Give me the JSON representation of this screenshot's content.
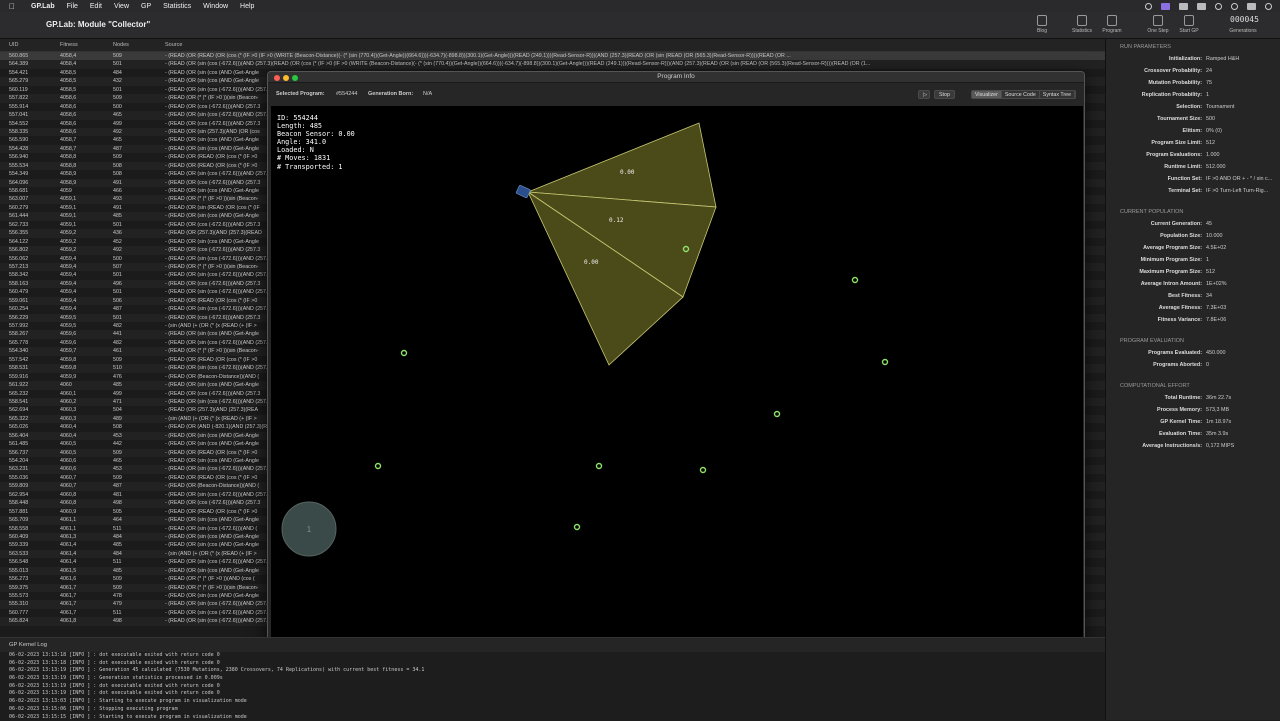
{
  "menubar": {
    "app_name": "GP.Lab",
    "items": [
      "File",
      "Edit",
      "View",
      "GP",
      "Statistics",
      "Window",
      "Help"
    ]
  },
  "window": {
    "title": "GP.Lab: Module \"Collector\""
  },
  "toolbar": {
    "blog": "Blog",
    "statistics": "Statistics",
    "program": "Program",
    "one_step": "One Step",
    "start_gp": "Start GP",
    "generations_value": "000045",
    "generations_label": "Generations"
  },
  "table": {
    "headers": {
      "uid": "UID",
      "fitness": "Fitness",
      "nodes": "Nodes",
      "source": "Source"
    },
    "selected_full_source": "- (READ (OR (READ (OR (cos (* (IF >0 (IF >0 (WRITE (Beacon-Distance)(- (* (sin (770.4))(Get-Angle))(664.6)))(-634.7)(-898.8))(300.1)(Get-Angle)))(READ (249.1)))(Read-Sensor-R)))(AND (257.3)(READ (OR (sin (READ (OR (565.3)(Read-Sensor-R))))(READ (OR ...",
    "second_full_source": "- (READ (OR (sin (cos (-672.6)))(AND (257.3)(READ (OR (cos (* (IF >0 (IF >0 (WRITE (Beacon-Distance)(- (* (sin (770.4))(Get-Angle))(664.6)))(-634.7)(-898.8))(300.1)(Get-Angle)))(READ (249.1)))(Read-Sensor-R)))(AND (257.3)(READ (OR (sin (READ (OR (565.3)(Read-Sensor-R))))(READ (OR (1...",
    "rows": [
      [
        "560.865",
        "4058,4",
        "509",
        "- (READ (OR (READ (OR (cos (* (IF >0 (IF >0 (WRITE (Beacon-Distance"
      ],
      [
        "564.389",
        "4058,4",
        "501",
        "- (READ (OR (sin (cos (-672.6)))(AND (257.3)(READ (OR (cos (* (IF >0"
      ],
      [
        "554.421",
        "4058,5",
        "484",
        "- (READ (OR (sin (cos (AND (Get-Angle"
      ],
      [
        "565.279",
        "4058,5",
        "432",
        "- (READ (OR (sin (cos (AND (Get-Angle"
      ],
      [
        "560.119",
        "4058,5",
        "501",
        "- (READ (OR (sin (cos (-672.6)))(AND (257."
      ],
      [
        "557.822",
        "4058,6",
        "509",
        "- (READ (OR (* (* (IF >0 ))(sin (Beacon-"
      ],
      [
        "555.914",
        "4058,6",
        "500",
        "- (READ (OR (cos (-672.6)))(AND (257.3"
      ],
      [
        "557.041",
        "4058,6",
        "465",
        "- (READ (OR (sin (cos (-672.6)))(AND (257."
      ],
      [
        "554.552",
        "4058,6",
        "499",
        "- (READ (OR (cos (-672.6)))(AND (257.3"
      ],
      [
        "558.335",
        "4058,6",
        "492",
        "- (READ (OR (sin (257.3)(AND (OR (cos"
      ],
      [
        "565.590",
        "4058,7",
        "465",
        "- (READ (OR (sin (cos (AND (Get-Angle"
      ],
      [
        "554.428",
        "4058,7",
        "487",
        "- (READ (OR (sin (cos (AND (Get-Angle"
      ],
      [
        "556.940",
        "4058,8",
        "509",
        "- (READ (OR (READ (OR (cos (* (IF >0"
      ],
      [
        "555.534",
        "4058,8",
        "508",
        "- (READ (OR (READ (OR (cos (* (IF >0"
      ],
      [
        "554.349",
        "4058,9",
        "508",
        "- (READ (OR (sin (cos (-672.6)))(AND (257."
      ],
      [
        "564.096",
        "4058,9",
        "491",
        "- (READ (OR (cos (-672.6)))(AND (257.3"
      ],
      [
        "558.681",
        "4059",
        "466",
        "- (READ (OR (sin (cos (AND (Get-Angle"
      ],
      [
        "563.007",
        "4059,1",
        "493",
        "- (READ (OR (* (* (IF >0 ))(sin (Beacon-"
      ],
      [
        "560.279",
        "4059,1",
        "491",
        "- (READ (OR (sin (READ (OR (cos (* (IF"
      ],
      [
        "561.444",
        "4059,1",
        "485",
        "- (READ (OR (sin (cos (AND (Get-Angle"
      ],
      [
        "562.733",
        "4059,1",
        "501",
        "- (READ (OR (cos (-672.6)))(AND (257.3"
      ],
      [
        "556.355",
        "4059,2",
        "436",
        "- (READ (OR (257.3)(AND (257.3)(READ"
      ],
      [
        "564.122",
        "4059,2",
        "452",
        "- (READ (OR (sin (cos (AND (Get-Angle"
      ],
      [
        "556.802",
        "4059,2",
        "492",
        "- (READ (OR (cos (-672.6)))(AND (257.3"
      ],
      [
        "556.062",
        "4059,4",
        "500",
        "- (READ (OR (sin (cos (-672.6)))(AND (257."
      ],
      [
        "557.213",
        "4059,4",
        "507",
        "- (READ (OR (* (* (IF >0 ))(sin (Beacon-"
      ],
      [
        "558.342",
        "4059,4",
        "501",
        "- (READ (OR (sin (cos (-672.6)))(AND (257."
      ],
      [
        "558.163",
        "4059,4",
        "496",
        "- (READ (OR (cos (-672.6)))(AND (257.3"
      ],
      [
        "560.479",
        "4059,4",
        "501",
        "- (READ (OR (sin (cos (-672.6)))(AND (257."
      ],
      [
        "559.061",
        "4059,4",
        "506",
        "- (READ (OR (READ (OR (cos (* (IF >0"
      ],
      [
        "560.254",
        "4059,4",
        "487",
        "- (READ (OR (sin (cos (-672.6)))(AND (257."
      ],
      [
        "556.229",
        "4059,5",
        "501",
        "- (READ (OR (cos (-672.6)))(AND (257.3"
      ],
      [
        "557.992",
        "4059,5",
        "482",
        "- (sin (AND (+ (OR (* (x (READ (+ (IF >"
      ],
      [
        "558.267",
        "4059,6",
        "441",
        "- (READ (OR (sin (cos (AND (Get-Angle"
      ],
      [
        "565.778",
        "4059,6",
        "482",
        "- (READ (OR (sin (cos (-672.6)))(AND (257."
      ],
      [
        "554.340",
        "4059,7",
        "461",
        "- (READ (OR (* (* (IF >0 ))(sin (Beacon-"
      ],
      [
        "557.542",
        "4059,8",
        "509",
        "- (READ (OR (READ (OR (cos (* (IF >0"
      ],
      [
        "558.531",
        "4059,8",
        "510",
        "- (READ (OR (sin (cos (-672.6)))(AND (257."
      ],
      [
        "559.916",
        "4059,9",
        "476",
        "- (READ (OR (Beacon-Distance))(AND ("
      ],
      [
        "561.922",
        "4060",
        "485",
        "- (READ (OR (sin (cos (AND (Get-Angle"
      ],
      [
        "565.232",
        "4060,1",
        "499",
        "- (READ (OR (cos (-672.6)))(AND (257.3"
      ],
      [
        "558.541",
        "4060,2",
        "471",
        "- (READ (OR (sin (cos (-672.6)))(AND (257."
      ],
      [
        "562.694",
        "4060,3",
        "504",
        "- (READ (OR (257.3)(AND (257.3)(REA"
      ],
      [
        "565.322",
        "4060,3",
        "489",
        "- (sin (AND (+ (OR (* (x (READ (+ (IF >"
      ],
      [
        "565.026",
        "4060,4",
        "508",
        "- (READ (OR (AND (-820.1)(AND (257.3)(REA"
      ],
      [
        "556.404",
        "4060,4",
        "453",
        "- (READ (OR (sin (cos (AND (Get-Angle"
      ],
      [
        "561.485",
        "4060,5",
        "442",
        "- (READ (OR (sin (cos (AND (Get-Angle"
      ],
      [
        "556.737",
        "4060,5",
        "509",
        "- (READ (OR (READ (OR (cos (* (IF >0"
      ],
      [
        "554.204",
        "4060,6",
        "465",
        "- (READ (OR (sin (cos (AND (Get-Angle"
      ],
      [
        "563.231",
        "4060,6",
        "453",
        "- (READ (OR (sin (cos (-672.6)))(AND (257."
      ],
      [
        "555.036",
        "4060,7",
        "509",
        "- (READ (OR (READ (OR (cos (* (IF >0"
      ],
      [
        "559.809",
        "4060,7",
        "487",
        "- (READ (OR (Beacon-Distance))(AND ("
      ],
      [
        "562.954",
        "4060,8",
        "481",
        "- (READ (OR (sin (cos (-672.6)))(AND (257."
      ],
      [
        "558.448",
        "4060,8",
        "498",
        "- (READ (OR (cos (-672.6)))(AND (257.3"
      ],
      [
        "557.881",
        "4060,9",
        "505",
        "- (READ (OR (READ (OR (cos (* (IF >0"
      ],
      [
        "565.709",
        "4061,1",
        "464",
        "- (READ (OR (sin (cos (AND (Get-Angle"
      ],
      [
        "558.558",
        "4061,1",
        "511",
        "- (READ (OR (sin (cos (-672.6)))(AND ("
      ],
      [
        "560.409",
        "4061,3",
        "484",
        "- (READ (OR (sin (cos (AND (Get-Angle"
      ],
      [
        "559.339",
        "4061,4",
        "485",
        "- (READ (OR (sin (cos (AND (Get-Angle"
      ],
      [
        "563.533",
        "4061,4",
        "484",
        "- (sin (AND (+ (OR (* (x (READ (+ (IF >"
      ],
      [
        "556.548",
        "4061,4",
        "511",
        "- (READ (OR (sin (cos (-672.6)))(AND (257."
      ],
      [
        "555.013",
        "4061,5",
        "485",
        "- (READ (OR (sin (cos (AND (Get-Angle"
      ],
      [
        "556.273",
        "4061,6",
        "509",
        "- (READ (OR (* (* (IF >0 ))(AND (cos ("
      ],
      [
        "559.375",
        "4061,7",
        "509",
        "- (READ (OR (* (* (IF >0 ))(sin (Beacon-"
      ],
      [
        "555.573",
        "4061,7",
        "478",
        "- (READ (OR (sin (cos (AND (Get-Angle"
      ],
      [
        "555.310",
        "4061,7",
        "479",
        "- (READ (OR (sin (cos (-672.6)))(AND (257."
      ],
      [
        "560.777",
        "4061,7",
        "511",
        "- (READ (OR (sin (cos (-672.6)))(AND (257."
      ],
      [
        "565.824",
        "4061,8",
        "498",
        "- (READ (OR (sin (cos (-672.6)))(AND (257."
      ]
    ]
  },
  "program_info": {
    "title": "Program Info",
    "selected_program_label": "Selected Program:",
    "selected_program_value": "#554244",
    "generation_born_label": "Generation Born:",
    "generation_born_value": "N/A",
    "stop_label": "Stop",
    "tabs": [
      "Visualizer",
      "Source Code",
      "Syntax Tree"
    ],
    "stats": [
      "ID: 554244",
      "Length: 485",
      "Beacon Sensor: 0.00",
      "Angle: 341.0",
      "Loaded: N",
      "# Moves: 1831",
      "# Transported: 1"
    ],
    "sensor_readings": [
      "0.00",
      "0.12",
      "0.00"
    ],
    "home_label": "1",
    "beacon_count": 10
  },
  "log": {
    "title": "GP Kernel Log",
    "lines": [
      "06-02-2023 13:13:18 [INFO   ] :  dot executable exited with return code 0",
      "06-02-2023 13:13:18 [INFO   ] :  dot executable exited with return code 0",
      "06-02-2023 13:13:19 [INFO   ] :  Generation 45 calculated (7530 Mutations, 2380 Crossovers, 74 Replications) with current best fitness = 34.1",
      "06-02-2023 13:13:19 [INFO   ] :  Generation statistics processed in 0.009s",
      "06-02-2023 13:13:19 [INFO   ] :  dot executable exited with return code 0",
      "06-02-2023 13:13:19 [INFO   ] :  dot executable exited with return code 0",
      "06-02-2023 13:13:03 [INFO   ] :  Starting to execute program in visualization mode",
      "06-02-2023 13:15:06 [INFO   ] :  Stopping executing program",
      "06-02-2023 13:15:15 [INFO   ] :  Starting to execute program in visualization mode"
    ]
  },
  "panel": {
    "run_parameters": {
      "title": "RUN PARAMETERS",
      "rows": [
        [
          "Initialization:",
          "Ramped H&H"
        ],
        [
          "Crossover Probability:",
          "24"
        ],
        [
          "Mutation Probability:",
          "75"
        ],
        [
          "Replication Probability:",
          "1"
        ],
        [
          "Selection:",
          "Tournament"
        ],
        [
          "Tournament Size:",
          "500"
        ],
        [
          "Elitism:",
          "0% (0)"
        ],
        [
          "Program Size Limit:",
          "512"
        ],
        [
          "Program Evaluations:",
          "1.000"
        ],
        [
          "Runtime Limit:",
          "512.000"
        ],
        [
          "Function Set:",
          "IF >0 AND OR + - * / sin c..."
        ],
        [
          "Terminal Set:",
          "IF >0 Turn-Left Turn-Rig..."
        ]
      ]
    },
    "current_population": {
      "title": "CURRENT POPULATION",
      "rows": [
        [
          "Current Generation:",
          "45"
        ],
        [
          "Population Size:",
          "10.000"
        ],
        [
          "Average Program Size:",
          "4.5E+02"
        ],
        [
          "Minimum Program Size:",
          "1"
        ],
        [
          "Maximum Program Size:",
          "512"
        ],
        [
          "Average Intron Amount:",
          "1E+02%"
        ],
        [
          "Best Fitness:",
          "34"
        ],
        [
          "Average Fitness:",
          "7.3E+03"
        ],
        [
          "Fitness Variance:",
          "7.8E+06"
        ]
      ]
    },
    "program_evaluation": {
      "title": "PROGRAM EVALUATION",
      "rows": [
        [
          "Programs Evaluated:",
          "450.000"
        ],
        [
          "Programs Aborted:",
          "0"
        ]
      ]
    },
    "computational_effort": {
      "title": "COMPUTATIONAL EFFORT",
      "rows": [
        [
          "Total Runtime:",
          "36m 22.7s"
        ],
        [
          "Process Memory:",
          "573,3 MB"
        ],
        [
          "GP Kernel Time:",
          "1m 18.97s"
        ],
        [
          "Evaluation Time:",
          "35m  3.9s"
        ],
        [
          "Average Instructions/s:",
          "0,172 MIPS"
        ]
      ]
    }
  },
  "colors": {
    "sensor_fill": "#58581e",
    "sensor_stroke": "#c8c873",
    "beacon": "#8ee46a",
    "home_circle": "#3a4a48",
    "agent": "#2a4f8c"
  }
}
